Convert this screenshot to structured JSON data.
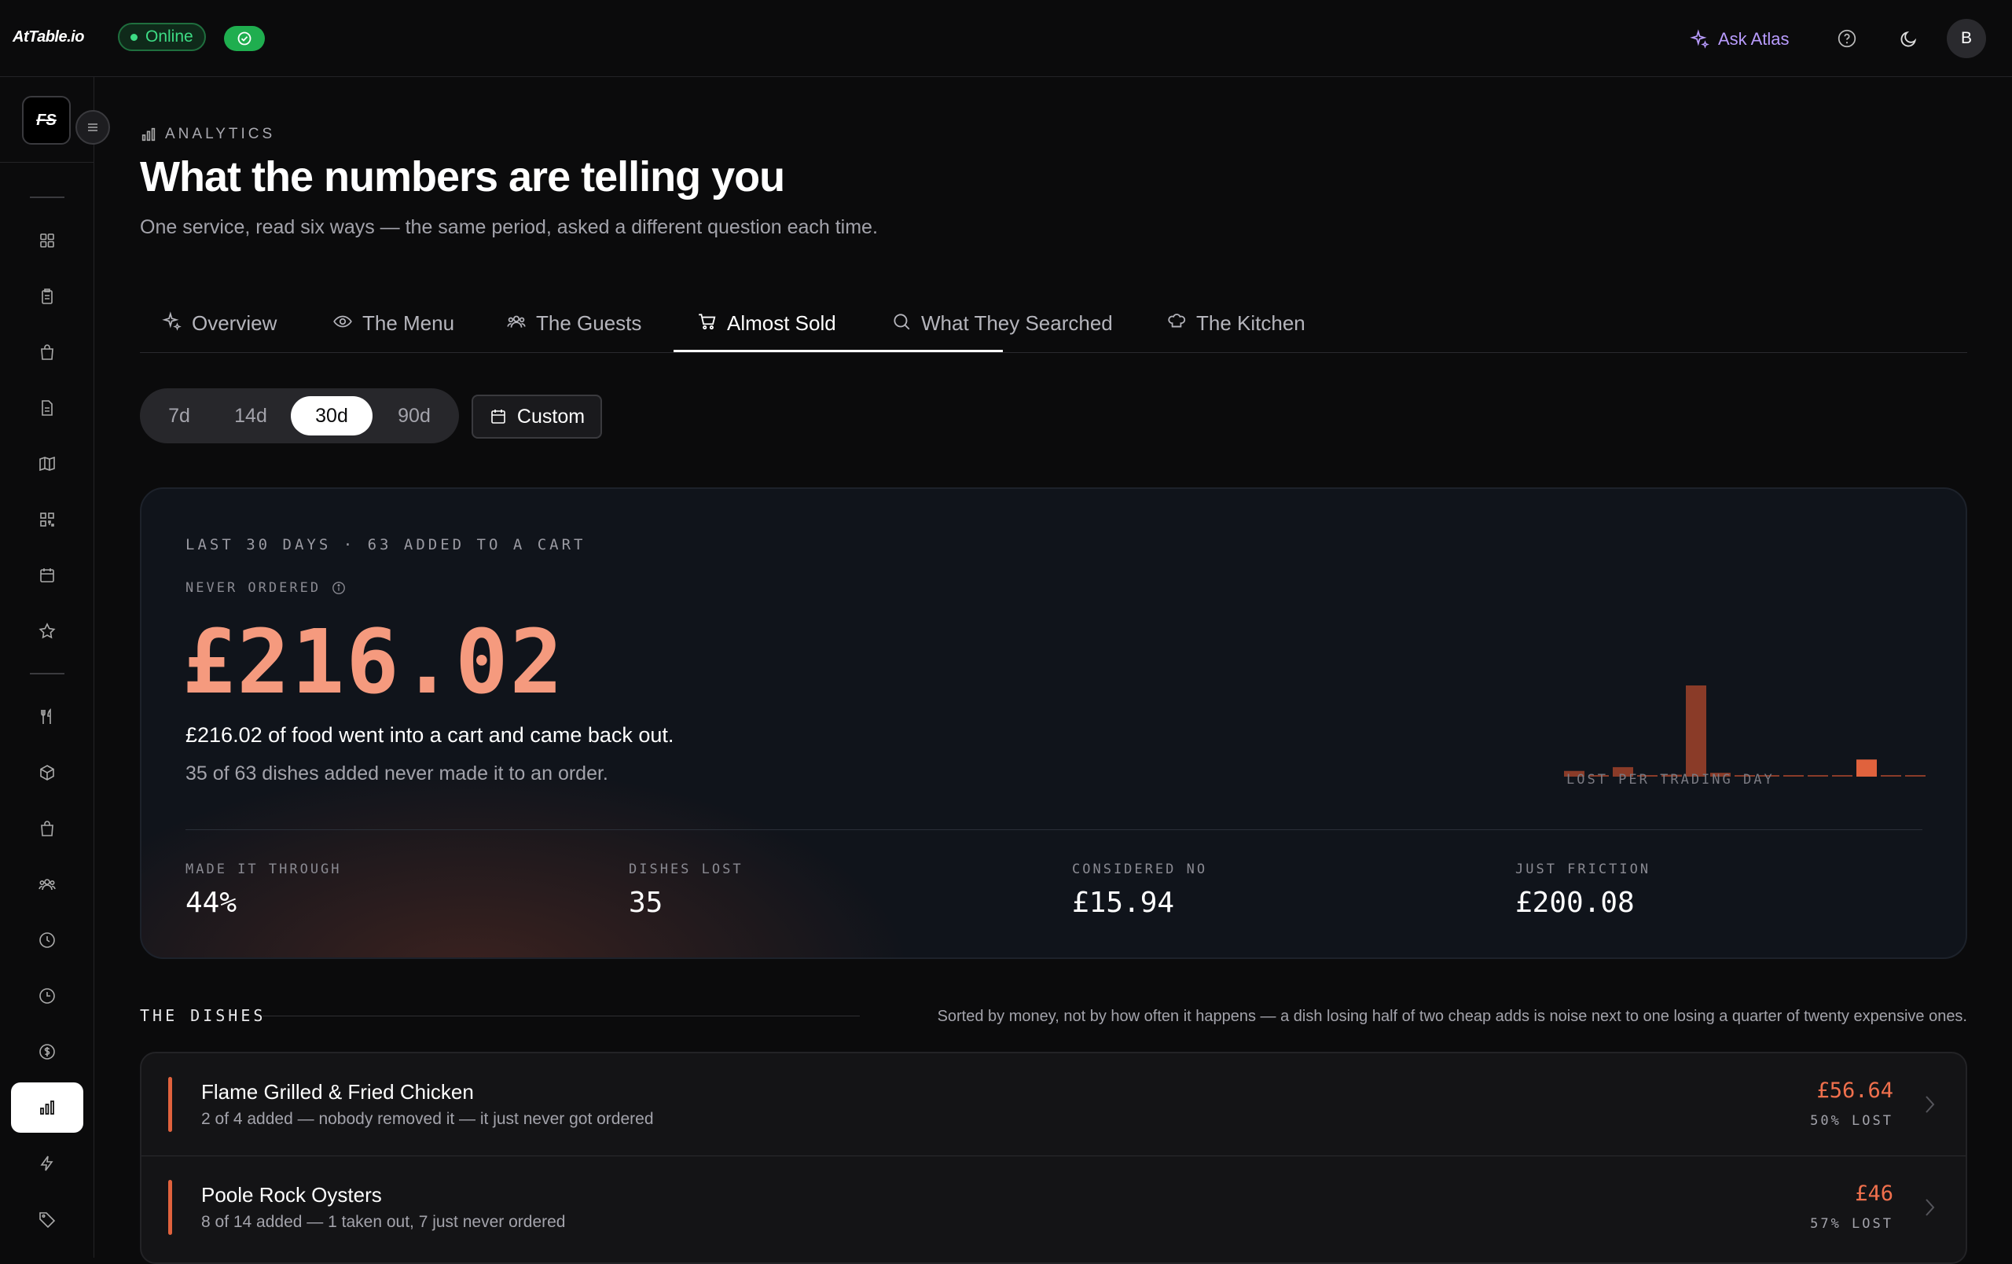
{
  "brand": "AtTable.io",
  "status": {
    "label": "Online"
  },
  "header": {
    "ask_label": "Ask Atlas",
    "avatar_initial": "B"
  },
  "sidebar": {
    "logo_text": "FS"
  },
  "page": {
    "eyebrow": "ANALYTICS",
    "title": "What the numbers are telling you",
    "subtitle": "One service, read six ways — the same period, asked a different question each time."
  },
  "tabs": [
    {
      "label": "Overview",
      "icon": "sparkles-icon"
    },
    {
      "label": "The Menu",
      "icon": "eye-icon"
    },
    {
      "label": "The Guests",
      "icon": "users-icon"
    },
    {
      "label": "Almost Sold",
      "icon": "cart-icon",
      "active": true
    },
    {
      "label": "What They Searched",
      "icon": "search-icon"
    },
    {
      "label": "The Kitchen",
      "icon": "chef-hat-icon"
    }
  ],
  "range": {
    "options": [
      "7d",
      "14d",
      "30d",
      "90d"
    ],
    "selected": "30d",
    "custom_label": "Custom"
  },
  "hero": {
    "eyebrow": "LAST 30 DAYS · 63 ADDED TO A CART",
    "never_label": "NEVER ORDERED",
    "amount": "£216.02",
    "line1": "£216.02 of food went into a cart and came back out.",
    "line2": "35 of 63 dishes added never made it to an order.",
    "chart_label": "LOST PER TRADING DAY",
    "stats": [
      {
        "label": "MADE IT THROUGH",
        "value": "44%"
      },
      {
        "label": "DISHES LOST",
        "value": "35"
      },
      {
        "label": "CONSIDERED NO",
        "value": "£15.94"
      },
      {
        "label": "JUST FRICTION",
        "value": "£200.08"
      }
    ]
  },
  "chart_data": {
    "type": "bar",
    "title": "",
    "xlabel": "LOST PER TRADING DAY",
    "ylabel": "",
    "values": [
      6,
      1,
      10,
      1,
      2,
      96,
      4,
      1,
      1,
      1,
      1,
      1,
      18,
      1,
      1
    ],
    "highlight_index": 12,
    "colors": {
      "bar": "#8a3b28",
      "highlight": "#e0623d"
    }
  },
  "dishes": {
    "label": "THE DISHES",
    "note": "Sorted by money, not by how often it happens — a dish losing half of two cheap adds is noise next to one losing a quarter of twenty expensive ones.",
    "items": [
      {
        "name": "Flame Grilled & Fried Chicken",
        "sub": "2 of 4 added — nobody removed it — it just never got ordered",
        "money": "£56.64",
        "pct": "50% LOST"
      },
      {
        "name": "Poole Rock Oysters",
        "sub": "8 of 14 added — 1 taken out, 7 just never ordered",
        "money": "£46",
        "pct": "57% LOST"
      }
    ]
  },
  "colors": {
    "accent_salmon": "#f59a7e",
    "loss_red": "#e0623d",
    "online_green": "#3ddc84",
    "atlas_purple": "#b99cff"
  }
}
